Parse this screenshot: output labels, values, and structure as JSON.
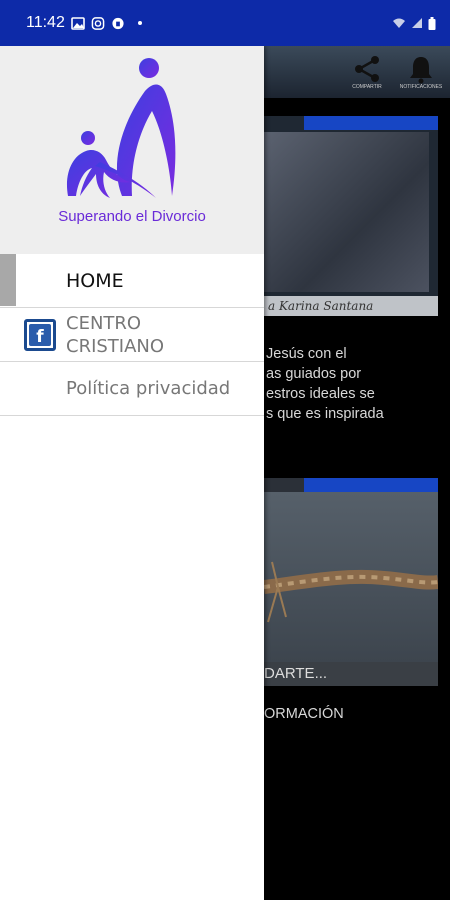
{
  "status_bar": {
    "time": "11:42",
    "icons": [
      "gallery-icon",
      "instagram-icon",
      "vpn-icon",
      "dot-icon"
    ],
    "right_icons": [
      "wifi-icon",
      "signal-icon",
      "battery-icon"
    ]
  },
  "drawer": {
    "logo_text": "Superando el Divorcio",
    "brand_color": "#6a2bd8",
    "items": [
      {
        "label": "HOME",
        "selected": true
      },
      {
        "label": "CENTRO CRISTIANO",
        "icon": "facebook-icon"
      },
      {
        "label": "Política privacidad"
      }
    ]
  },
  "background": {
    "toolbar_actions": [
      {
        "icon": "share-icon",
        "label": "COMPARTIR"
      },
      {
        "icon": "bell-icon",
        "label": "NOTIFICACIONES"
      }
    ],
    "card1_caption": "a Karina Santana",
    "body_text": "Jesús con el\nas guiados por\nestros ideales se\ns que es inspirada",
    "card2_caption": "DARTE...",
    "info_text": "ORMACIÓN"
  }
}
